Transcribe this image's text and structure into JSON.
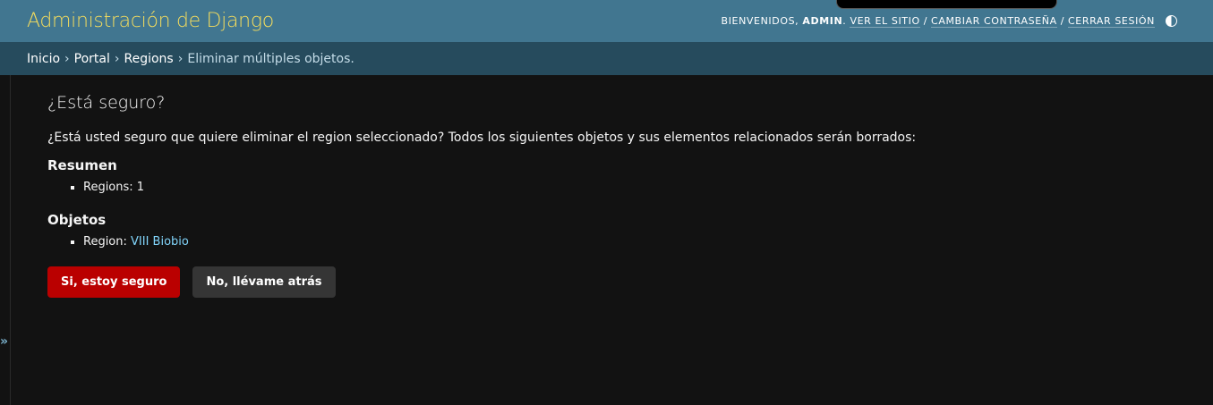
{
  "header": {
    "title": "Administración de Django",
    "welcome": "Bienvenidos,",
    "username": "admin",
    "view_site": "Ver el sitio",
    "change_password": "Cambiar contraseña",
    "logout": "Cerrar sesión"
  },
  "breadcrumbs": {
    "home": "Inicio",
    "app": "Portal",
    "model": "Regions",
    "current": "Eliminar múltiples objetos."
  },
  "main": {
    "heading": "¿Está seguro?",
    "message": "¿Está usted seguro que quiere eliminar el region seleccionado? Todos los siguientes objetos y sus elementos relacionados serán borrados:",
    "summary_title": "Resumen",
    "summary_item": "Regions: 1",
    "objects_title": "Objetos",
    "object_prefix": "Region: ",
    "object_link": "VIII Biobio",
    "confirm_button": "Si, estoy seguro",
    "cancel_button": "No, llévame atrás"
  },
  "colors": {
    "header_bg": "#417690",
    "breadcrumb_bg": "#264b5d",
    "brand": "#f5dd5d",
    "danger": "#ba0000",
    "link": "#81d4fa"
  }
}
